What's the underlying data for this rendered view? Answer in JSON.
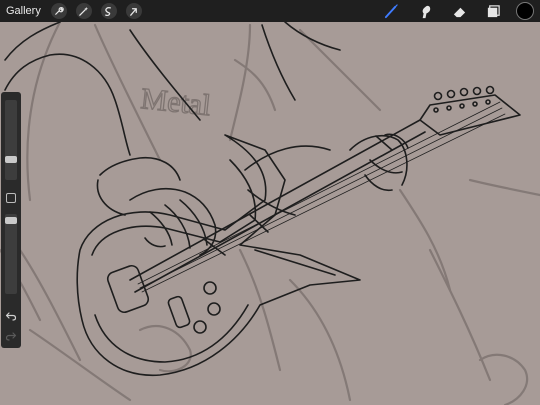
{
  "app": {
    "gallery_label": "Gallery"
  },
  "toolbar_left": [
    {
      "name": "actions-wrench-icon"
    },
    {
      "name": "adjustments-wand-icon"
    },
    {
      "name": "selection-icon"
    },
    {
      "name": "transform-arrow-icon"
    }
  ],
  "toolbar_right": [
    {
      "name": "brush-icon",
      "active": true
    },
    {
      "name": "smudge-icon",
      "active": false
    },
    {
      "name": "eraser-icon",
      "active": false
    },
    {
      "name": "layers-icon",
      "active": false
    }
  ],
  "current_color": "#000000",
  "accent_color": "#3f7cff",
  "canvas_background": "#a79b97",
  "sketch_text": "Metal",
  "sidebar": {
    "brush_size_level": 0.5,
    "opacity_level": 0.5
  }
}
